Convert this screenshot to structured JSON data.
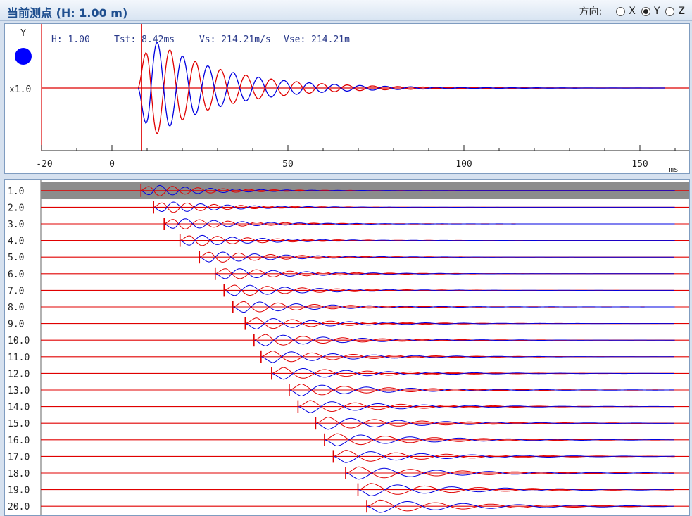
{
  "header": {
    "title": "当前测点 (H: 1.00 m)",
    "direction_label": "方向:",
    "options": [
      {
        "label": "X",
        "selected": false
      },
      {
        "label": "Y",
        "selected": true
      },
      {
        "label": "Z",
        "selected": false
      }
    ]
  },
  "top_plot": {
    "channel": "Y",
    "indicator_color": "#0000ff",
    "gain": "x1.0",
    "info": {
      "h": "H: 1.00",
      "tst": "Tst: 8.42ms",
      "vs": "Vs: 214.21m/s",
      "vse": "Vse: 214.21m"
    },
    "unit": "ms",
    "tick_labels": [
      "-20",
      "0",
      "50",
      "100",
      "150"
    ],
    "x_range": [
      -20,
      164
    ]
  },
  "colors": {
    "trace_red": "#e00000",
    "trace_blue": "#0000e0",
    "selected_row": "#8c8c8c"
  },
  "depth_rows": [
    {
      "label": "1.0",
      "tst": 8.42,
      "selected": true
    },
    {
      "label": "2.0",
      "tst": 12.0
    },
    {
      "label": "3.0",
      "tst": 15.0
    },
    {
      "label": "4.0",
      "tst": 19.5
    },
    {
      "label": "5.0",
      "tst": 25.0
    },
    {
      "label": "6.0",
      "tst": 29.5
    },
    {
      "label": "7.0",
      "tst": 32.0
    },
    {
      "label": "8.0",
      "tst": 34.5
    },
    {
      "label": "9.0",
      "tst": 38.0
    },
    {
      "label": "10.0",
      "tst": 40.5
    },
    {
      "label": "11.0",
      "tst": 42.5
    },
    {
      "label": "12.0",
      "tst": 45.5
    },
    {
      "label": "13.0",
      "tst": 50.5
    },
    {
      "label": "14.0",
      "tst": 53.0
    },
    {
      "label": "15.0",
      "tst": 58.0
    },
    {
      "label": "16.0",
      "tst": 60.5
    },
    {
      "label": "17.0",
      "tst": 63.0
    },
    {
      "label": "18.0",
      "tst": 66.5
    },
    {
      "label": "19.0",
      "tst": 70.0
    },
    {
      "label": "20.0",
      "tst": 72.5
    }
  ]
}
